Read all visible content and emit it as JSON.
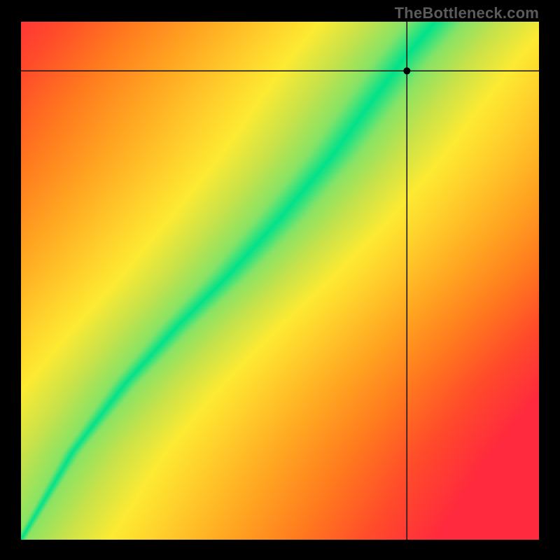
{
  "watermark": "TheBottleneck.com",
  "chart_data": {
    "type": "heatmap",
    "title": "",
    "xlabel": "",
    "ylabel": "",
    "xlim": [
      0,
      1
    ],
    "ylim": [
      0,
      1
    ],
    "axes_visible": false,
    "grid": false,
    "legend": false,
    "color_scale": {
      "name": "red-yellow-green-yellow-red (distance from ridge)",
      "stops": [
        {
          "t": 0.0,
          "hex": "#00e28a"
        },
        {
          "t": 0.1,
          "hex": "#7be36a"
        },
        {
          "t": 0.2,
          "hex": "#c8e24a"
        },
        {
          "t": 0.3,
          "hex": "#fdea32"
        },
        {
          "t": 0.4,
          "hex": "#ffcf2b"
        },
        {
          "t": 0.55,
          "hex": "#ffa521"
        },
        {
          "t": 0.7,
          "hex": "#ff7a1e"
        },
        {
          "t": 0.85,
          "hex": "#ff4b2a"
        },
        {
          "t": 1.0,
          "hex": "#ff2a3d"
        }
      ]
    },
    "ridge": {
      "description": "optimal-balance curve; color encodes |x - f(y)|",
      "points_xy": [
        [
          0.0,
          0.0
        ],
        [
          0.1,
          0.17
        ],
        [
          0.2,
          0.3
        ],
        [
          0.3,
          0.41
        ],
        [
          0.4,
          0.51
        ],
        [
          0.5,
          0.62
        ],
        [
          0.6,
          0.74
        ],
        [
          0.68,
          0.85
        ],
        [
          0.74,
          0.93
        ],
        [
          0.8,
          1.0
        ]
      ]
    },
    "ridge_half_width_x": {
      "description": "approximate green-band half-width in x units as a function of y",
      "points_y_w": [
        [
          0.0,
          0.01
        ],
        [
          0.2,
          0.02
        ],
        [
          0.4,
          0.035
        ],
        [
          0.6,
          0.05
        ],
        [
          0.8,
          0.055
        ],
        [
          1.0,
          0.06
        ]
      ]
    },
    "marker": {
      "x": 0.745,
      "y": 0.905,
      "crosshair": true
    }
  }
}
